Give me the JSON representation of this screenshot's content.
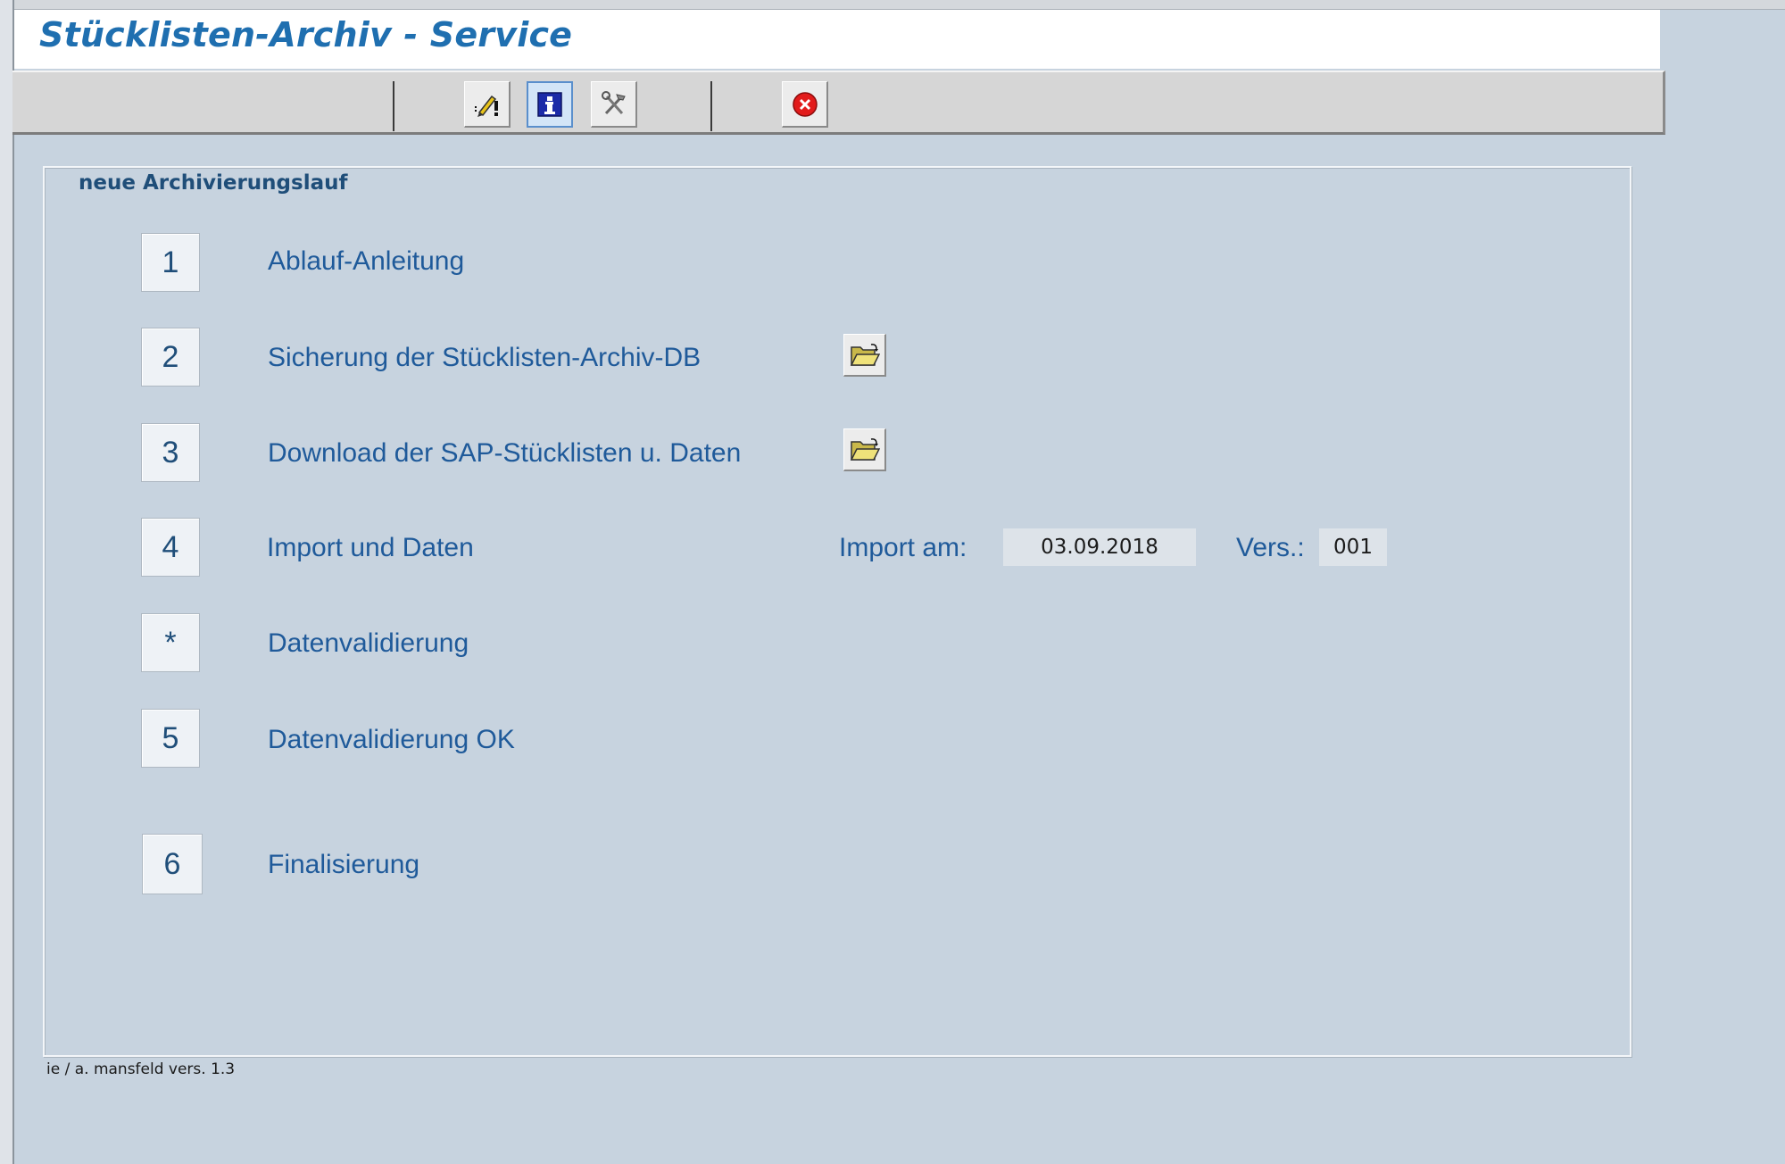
{
  "app": {
    "title": "Stücklisten-Archiv - Service"
  },
  "toolbar": {
    "buttons": [
      {
        "icon": "edit-warning-icon"
      },
      {
        "icon": "info-icon"
      },
      {
        "icon": "tools-icon"
      },
      {
        "icon": "close-icon"
      }
    ]
  },
  "group": {
    "title": "neue Archivierungslauf",
    "steps": [
      {
        "key": "1",
        "label": "Ablauf-Anleitung"
      },
      {
        "key": "2",
        "label": "Sicherung der Stücklisten-Archiv-DB",
        "action_icon": "folder-open-icon"
      },
      {
        "key": "3",
        "label": "Download der SAP-Stücklisten u. Daten",
        "action_icon": "folder-open-icon"
      },
      {
        "key": "4",
        "label": "Import und Daten"
      },
      {
        "key": "*",
        "label": "Datenvalidierung"
      },
      {
        "key": "5",
        "label": "Datenvalidierung OK"
      },
      {
        "key": "6",
        "label": "Finalisierung"
      }
    ],
    "import": {
      "date_label": "Import am:",
      "date_value": "03.09.2018",
      "version_label": "Vers.:",
      "version_value": "001"
    }
  },
  "footer": {
    "text": "ie / a. mansfeld vers. 1.3"
  },
  "colors": {
    "background": "#c7d3df",
    "title_text": "#1f6fb0",
    "label_text": "#1f5a9a",
    "group_title_text": "#1f4e79"
  }
}
